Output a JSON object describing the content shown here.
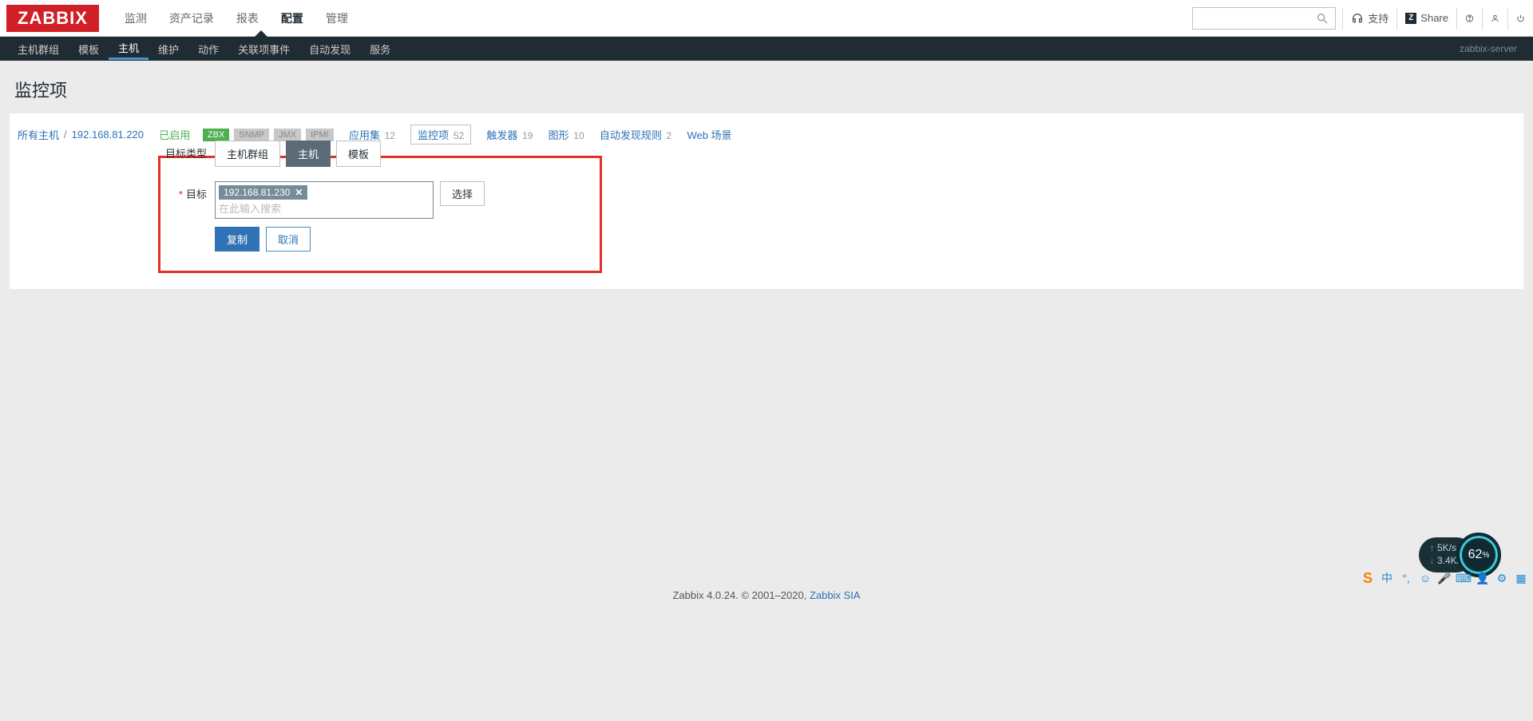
{
  "header": {
    "logo": "ZABBIX",
    "nav": [
      "监测",
      "资产记录",
      "报表",
      "配置",
      "管理"
    ],
    "nav_active_index": 3,
    "support": "支持",
    "share": "Share"
  },
  "subnav": {
    "items": [
      "主机群组",
      "模板",
      "主机",
      "维护",
      "动作",
      "关联项事件",
      "自动发现",
      "服务"
    ],
    "active_index": 2,
    "server": "zabbix-server"
  },
  "page": {
    "title": "监控项"
  },
  "breadcrumb": {
    "all_hosts": "所有主机",
    "host_ip": "192.168.81.220",
    "enabled": "已启用",
    "pills": {
      "zbx": "ZBX",
      "snmp": "SNMP",
      "jmx": "JMX",
      "ipmi": "IPMI"
    },
    "tabs": [
      {
        "label": "应用集",
        "count": "12"
      },
      {
        "label": "监控项",
        "count": "52",
        "active": true
      },
      {
        "label": "触发器",
        "count": "19"
      },
      {
        "label": "图形",
        "count": "10"
      },
      {
        "label": "自动发现规则",
        "count": "2"
      },
      {
        "label": "Web 场景",
        "count": ""
      }
    ]
  },
  "form": {
    "target_type_label": "目标类型",
    "target_type_options": [
      "主机群组",
      "主机",
      "模板"
    ],
    "target_type_active_index": 1,
    "target_label": "目标",
    "target_chip": "192.168.81.230",
    "target_placeholder": "在此输入搜索",
    "select_btn": "选择",
    "copy_btn": "复制",
    "cancel_btn": "取消"
  },
  "footer": {
    "left": "Zabbix 4.0.24. © 2001–2020, ",
    "link": "Zabbix SIA"
  },
  "widgets": {
    "net_up": "5K/s",
    "net_dn": "3.4K/s",
    "cpu": "62",
    "cpu_suffix": "%"
  }
}
